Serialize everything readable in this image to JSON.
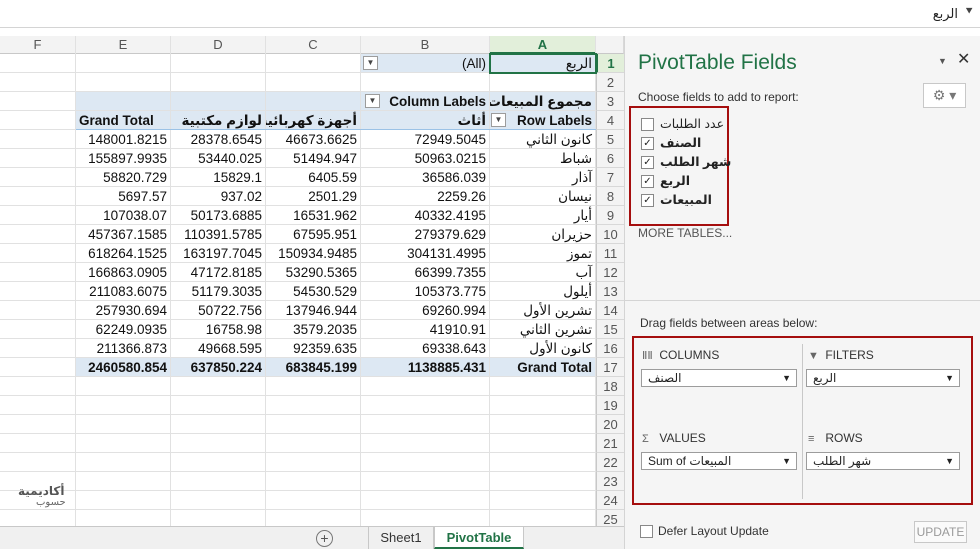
{
  "formula_bar": {
    "text": "الربع"
  },
  "columns": [
    "F",
    "E",
    "D",
    "C",
    "B",
    "A"
  ],
  "rows": [
    "1",
    "2",
    "3",
    "4",
    "5",
    "6",
    "7",
    "8",
    "9",
    "10",
    "11",
    "12",
    "13",
    "14",
    "15",
    "16",
    "17",
    "18",
    "19",
    "20",
    "21",
    "22",
    "23",
    "24",
    "25"
  ],
  "pivot": {
    "filter_value": "(All)",
    "filter_label": "الربع",
    "sum_label": "مجموع المبيعات",
    "column_labels": "Column Labels",
    "row_labels": "Row Labels",
    "col_headers": [
      "أثاث",
      "أجهزة كهربائية",
      "لوازم مكتبية",
      "Grand Total"
    ],
    "data_rows": [
      {
        "label": "كانون الثاني",
        "v": [
          "72949.5045",
          "46673.6625",
          "28378.6545",
          "148001.8215"
        ]
      },
      {
        "label": "شباط",
        "v": [
          "50963.0215",
          "51494.947",
          "53440.025",
          "155897.9935"
        ]
      },
      {
        "label": "آذار",
        "v": [
          "36586.039",
          "6405.59",
          "15829.1",
          "58820.729"
        ]
      },
      {
        "label": "نيسان",
        "v": [
          "2259.26",
          "2501.29",
          "937.02",
          "5697.57"
        ]
      },
      {
        "label": "أيار",
        "v": [
          "40332.4195",
          "16531.962",
          "50173.6885",
          "107038.07"
        ]
      },
      {
        "label": "حزيران",
        "v": [
          "279379.629",
          "67595.951",
          "110391.5785",
          "457367.1585"
        ]
      },
      {
        "label": "تموز",
        "v": [
          "304131.4995",
          "150934.9485",
          "163197.7045",
          "618264.1525"
        ]
      },
      {
        "label": "آب",
        "v": [
          "66399.7355",
          "53290.5365",
          "47172.8185",
          "166863.0905"
        ]
      },
      {
        "label": "أيلول",
        "v": [
          "105373.775",
          "54530.529",
          "51179.3035",
          "211083.6075"
        ]
      },
      {
        "label": "تشرين الأول",
        "v": [
          "69260.994",
          "137946.944",
          "50722.756",
          "257930.694"
        ]
      },
      {
        "label": "تشرين الثاني",
        "v": [
          "41910.91",
          "3579.2035",
          "16758.98",
          "62249.0935"
        ]
      },
      {
        "label": "كانون الأول",
        "v": [
          "69338.643",
          "92359.635",
          "49668.595",
          "211366.873"
        ]
      }
    ],
    "grand_total": {
      "label": "Grand Total",
      "v": [
        "1138885.431",
        "683845.199",
        "637850.224",
        "2460580.854"
      ]
    }
  },
  "tabs": {
    "sheet1": "Sheet1",
    "pivot": "PivotTable",
    "add": "+"
  },
  "logo": {
    "line1": "أكاديمية",
    "line2": "حسوب"
  },
  "pane": {
    "title": "PivotTable Fields",
    "choose": "Choose fields to add to report:",
    "fields": [
      {
        "label": "عدد الطلبات",
        "checked": false
      },
      {
        "label": "الصنف",
        "checked": true
      },
      {
        "label": "شهر الطلب",
        "checked": true
      },
      {
        "label": "الربع",
        "checked": true
      },
      {
        "label": "المبيعات",
        "checked": true
      }
    ],
    "more_tables": "MORE TABLES...",
    "drag": "Drag fields between areas below:",
    "areas": {
      "columns": {
        "title": "COLUMNS",
        "value": "الصنف"
      },
      "filters": {
        "title": "FILTERS",
        "value": "الربع"
      },
      "values": {
        "title": "VALUES",
        "value": "Sum of المبيعات"
      },
      "rows": {
        "title": "ROWS",
        "value": "شهر الطلب"
      }
    },
    "defer": "Defer Layout Update",
    "update": "UPDATE"
  },
  "colors": {
    "accent": "#217346",
    "highlight_border": "#a50e0e",
    "pivot_band": "#dde8f3"
  }
}
